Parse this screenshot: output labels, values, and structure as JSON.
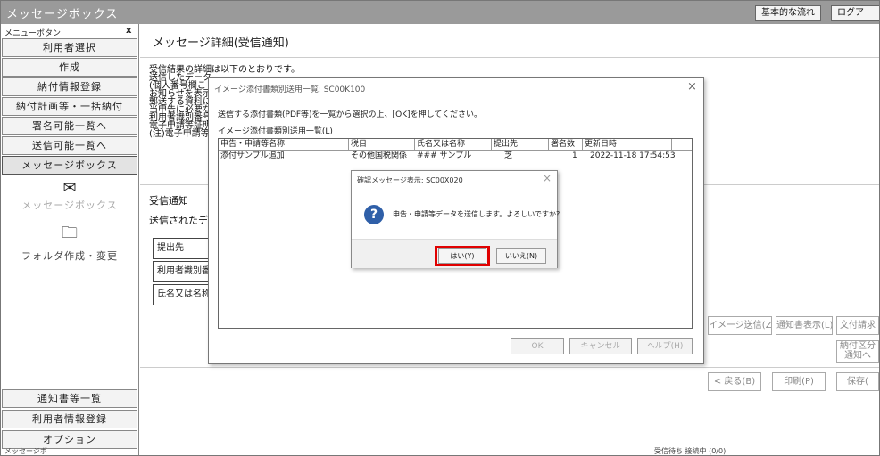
{
  "window": {
    "title": "メッセージボックス"
  },
  "header_buttons": {
    "basic_flow": "基本的な流れ",
    "logout": "ログア"
  },
  "sidebar": {
    "menu_label": "メニューボタン",
    "close_glyph": "x",
    "top_items": [
      "利用者選択",
      "作成",
      "納付情報登録",
      "納付計画等・一括納付",
      "署名可能一覧へ",
      "送信可能一覧へ",
      "メッセージボックス"
    ],
    "icons": [
      {
        "label": "メッセージボックス",
        "icon": "mail-icon"
      },
      {
        "label": "フォルダ作成・変更",
        "icon": "folder-icon"
      }
    ],
    "bottom_items": [
      "通知書等一覧",
      "利用者情報登録",
      "オプション"
    ]
  },
  "main": {
    "page_title": "メッセージ詳細(受信通知)",
    "background_lines": [
      "受信結果の詳細は以下のとおりです。",
      "送信したデータ",
      "(個人番号欄こ",
      "お知らせを表示",
      "郵送する資料に",
      "当申告に必要な",
      "利用者識別番号",
      "電子申請等証明",
      "(注)電子申請等"
    ],
    "section_label": "受信通知",
    "section_sub": "送信されたデー",
    "form_rows": [
      "提出先",
      "利用者識別番",
      "氏名又は名称"
    ],
    "side_buttons": [
      "イメージ送信(Z)",
      "通知書表示(L)",
      "文付請求"
    ],
    "side_button_2": "納付区分\n通知へ",
    "bottom_buttons": [
      "< 戻る(B)",
      "印刷(P)",
      "保存("
    ]
  },
  "dialog_list": {
    "title": "イメージ添付書類別送用一覧: SC00K100",
    "close_glyph": "×",
    "instruction": "送信する添付書類(PDF等)を一覧から選択の上、[OK]を押してください。",
    "list_label": "イメージ添付書類別送用一覧(L)",
    "columns": [
      "申告・申請等名称",
      "税目",
      "氏名又は名称",
      "提出先",
      "署名数",
      "更新日時"
    ],
    "rows": [
      [
        "添付サンプル追加",
        "その他国税関係",
        "### サンプル",
        "芝",
        "1",
        "2022-11-18 17:54:53"
      ]
    ],
    "buttons": [
      "OK",
      "キャンセル",
      "ヘルプ(H)"
    ]
  },
  "dialog_confirm": {
    "title": "確認メッセージ表示: SC00X020",
    "close_glyph": "×",
    "icon": "question-icon",
    "message": "申告・申請等データを送信します。よろしいですか?",
    "yes_label": "はい(Y)",
    "no_label": "いいえ(N)",
    "highlight_color": "#e00000"
  },
  "statusbar": {
    "left": "メッセージボ",
    "right": "受信待ち 接続中 (0/0)"
  }
}
